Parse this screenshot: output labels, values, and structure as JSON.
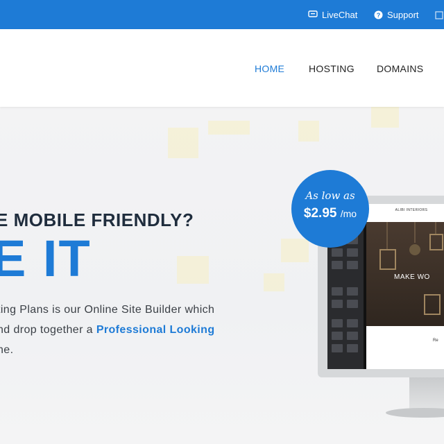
{
  "topbar": {
    "livechat_label": "LiveChat",
    "support_label": "Support"
  },
  "nav": {
    "items": [
      {
        "label": "HOME",
        "active": true
      },
      {
        "label": "HOSTING",
        "active": false
      },
      {
        "label": "DOMAINS",
        "active": false
      }
    ]
  },
  "hero": {
    "headline": "E MOBILE FRIENDLY?",
    "big_text": "E IT",
    "paragraph_line1": "ting Plans is our Online Site Builder which",
    "paragraph_line2_pre": "nd drop together a ",
    "paragraph_line2_highlight": "Professional Looking",
    "paragraph_line3": "ne."
  },
  "badge": {
    "as_low_as": "As low as",
    "price": "$2.95",
    "per": "/mo"
  },
  "mockup": {
    "site_brand": "ALIBI INTERIORS",
    "site_hero_text": "MAKE WO",
    "site_body_title": "Re"
  },
  "colors": {
    "brand_blue": "#1e7bd6",
    "text_dark": "#1f2d3d"
  }
}
